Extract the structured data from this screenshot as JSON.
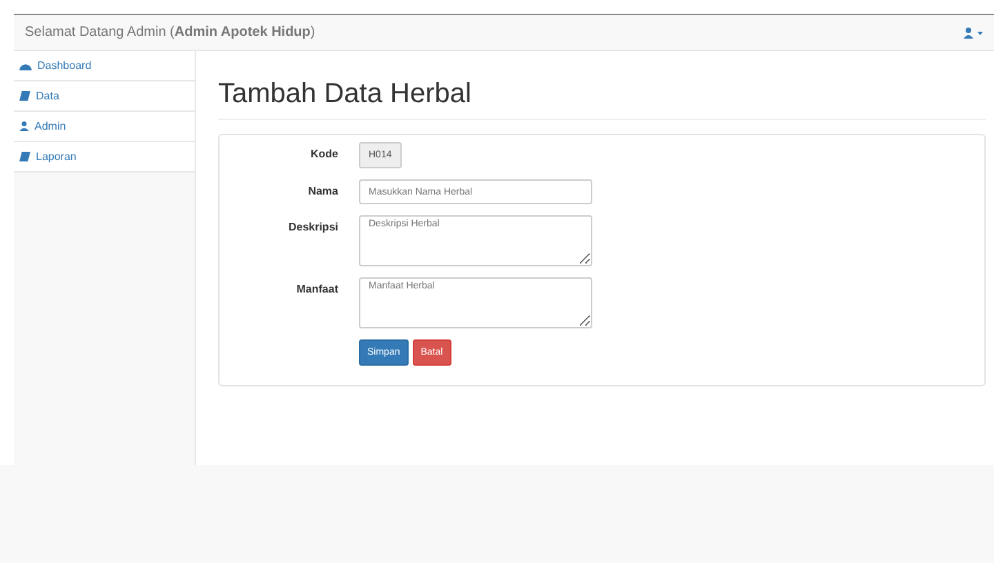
{
  "navbar": {
    "title": "Selamat Datang Admin (**Admin Apotek Hidup**)"
  },
  "sidebar": {
    "items": [
      {
        "label": "Dashboard"
      },
      {
        "label": "Data"
      },
      {
        "label": "Admin"
      },
      {
        "label": "Laporan"
      }
    ]
  },
  "page": {
    "title": "Tambah Data Herbal"
  },
  "form": {
    "fields": [
      {
        "label": "Kode",
        "kind": "readonly",
        "value": "H014"
      },
      {
        "label": "Nama",
        "kind": "input",
        "placeholder": "Masukkan Nama Herbal"
      },
      {
        "label": "Deskripsi",
        "kind": "textarea",
        "placeholder": "Deskripsi Herbal"
      },
      {
        "label": "Manfaat",
        "kind": "textarea",
        "placeholder": "Manfaat Herbal"
      }
    ],
    "buttons": [
      {
        "label": "Simpan",
        "kind": "primary"
      },
      {
        "label": "Batal",
        "kind": "danger"
      }
    ]
  }
}
